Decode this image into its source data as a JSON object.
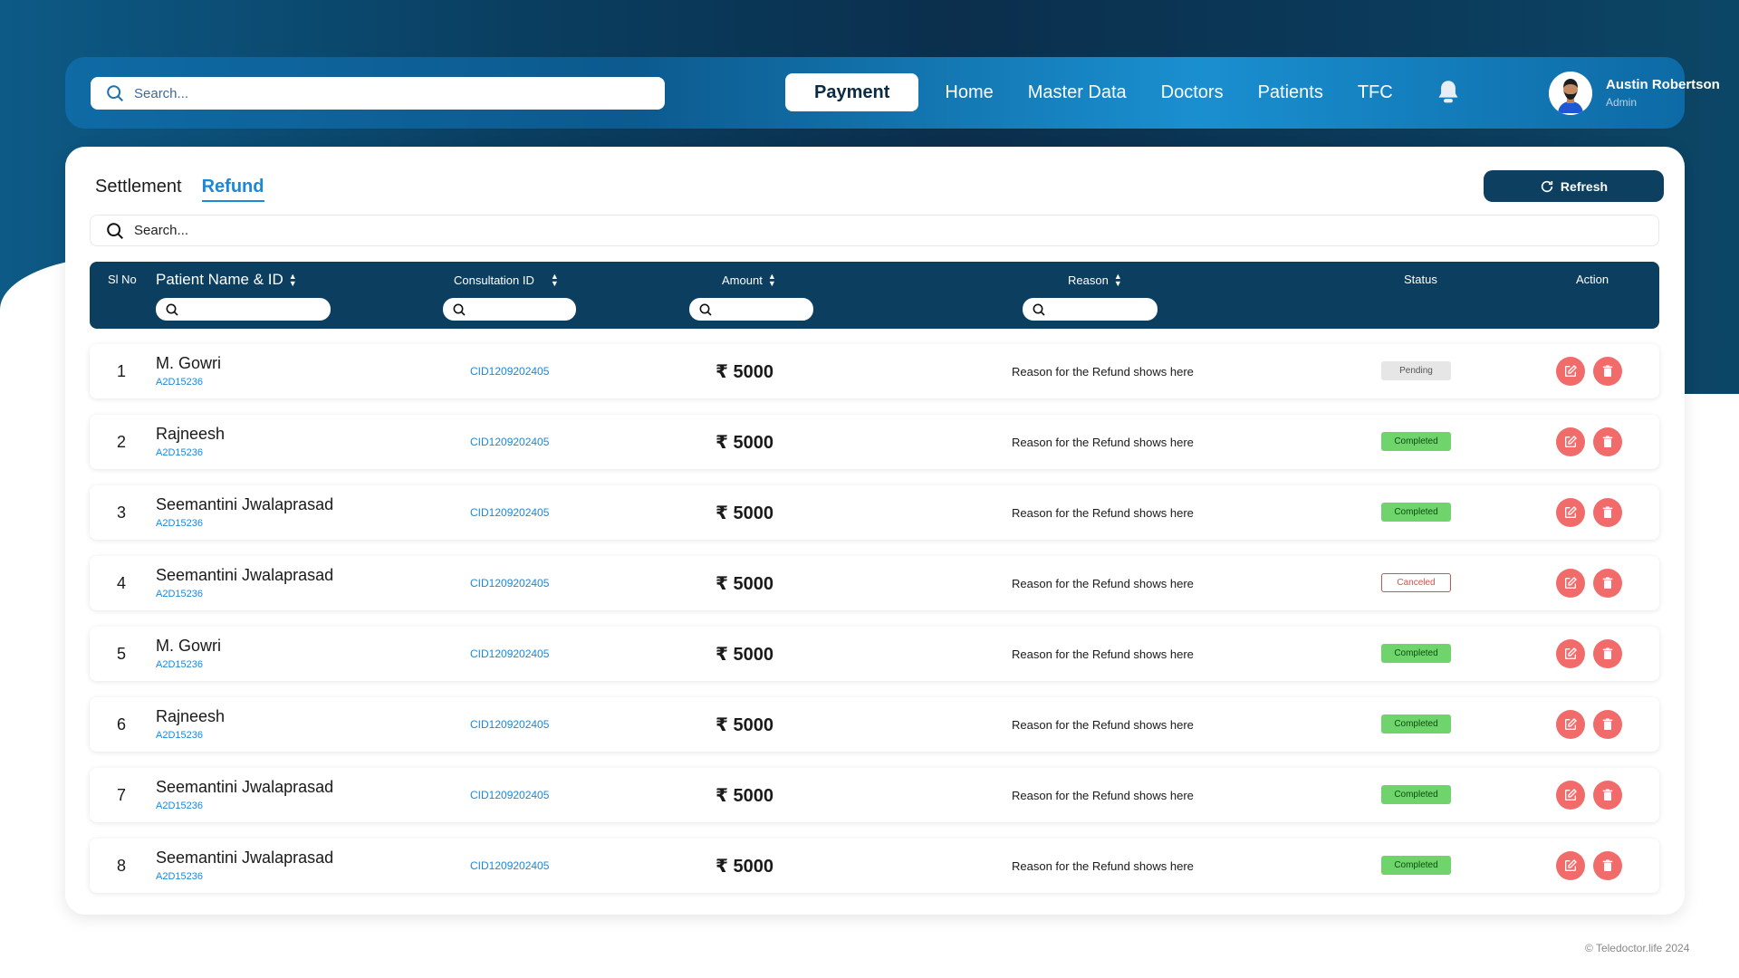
{
  "header": {
    "search_placeholder": "Search...",
    "nav": [
      "Payment",
      "Home",
      "Master Data",
      "Doctors",
      "Patients",
      "TFC"
    ],
    "active_nav": "Payment",
    "user": {
      "name": "Austin Robertson",
      "role": "Admin"
    }
  },
  "page": {
    "tabs": [
      "Settlement",
      "Refund"
    ],
    "active_tab": "Refund",
    "refresh_label": "Refresh",
    "search_placeholder": "Search..."
  },
  "table": {
    "headers": {
      "sl": "Sl No",
      "name": "Patient Name & ID",
      "cid": "Consultation ID",
      "amount": "Amount",
      "reason": "Reason",
      "status": "Status",
      "action": "Action"
    },
    "rows": [
      {
        "sl": "1",
        "name": "M. Gowri",
        "pid": "A2D15236",
        "cid": "CID1209202405",
        "amount": "₹ 5000",
        "reason": "Reason for the Refund shows here",
        "status": "Pending"
      },
      {
        "sl": "2",
        "name": "Rajneesh",
        "pid": "A2D15236",
        "cid": "CID1209202405",
        "amount": "₹ 5000",
        "reason": "Reason for the Refund shows here",
        "status": "Completed"
      },
      {
        "sl": "3",
        "name": "Seemantini Jwalaprasad",
        "pid": "A2D15236",
        "cid": "CID1209202405",
        "amount": "₹ 5000",
        "reason": "Reason for the Refund shows here",
        "status": "Completed"
      },
      {
        "sl": "4",
        "name": "Seemantini Jwalaprasad",
        "pid": "A2D15236",
        "cid": "CID1209202405",
        "amount": "₹ 5000",
        "reason": "Reason for the Refund shows here",
        "status": "Canceled"
      },
      {
        "sl": "5",
        "name": "M. Gowri",
        "pid": "A2D15236",
        "cid": "CID1209202405",
        "amount": "₹ 5000",
        "reason": "Reason for the Refund shows here",
        "status": "Completed"
      },
      {
        "sl": "6",
        "name": "Rajneesh",
        "pid": "A2D15236",
        "cid": "CID1209202405",
        "amount": "₹ 5000",
        "reason": "Reason for the Refund shows here",
        "status": "Completed"
      },
      {
        "sl": "7",
        "name": "Seemantini Jwalaprasad",
        "pid": "A2D15236",
        "cid": "CID1209202405",
        "amount": "₹ 5000",
        "reason": "Reason for the Refund shows here",
        "status": "Completed"
      },
      {
        "sl": "8",
        "name": "Seemantini Jwalaprasad",
        "pid": "A2D15236",
        "cid": "CID1209202405",
        "amount": "₹ 5000",
        "reason": "Reason for the Refund shows here",
        "status": "Completed"
      }
    ]
  },
  "footer": {
    "copyright": "© Teledoctor.life 2024"
  },
  "colors": {
    "primary": "#0c3e60",
    "link": "#1b88d8",
    "action": "#f26b6b",
    "completed": "#6fd46b",
    "canceled": "#e24b4b",
    "pending": "#e6e6e6"
  }
}
